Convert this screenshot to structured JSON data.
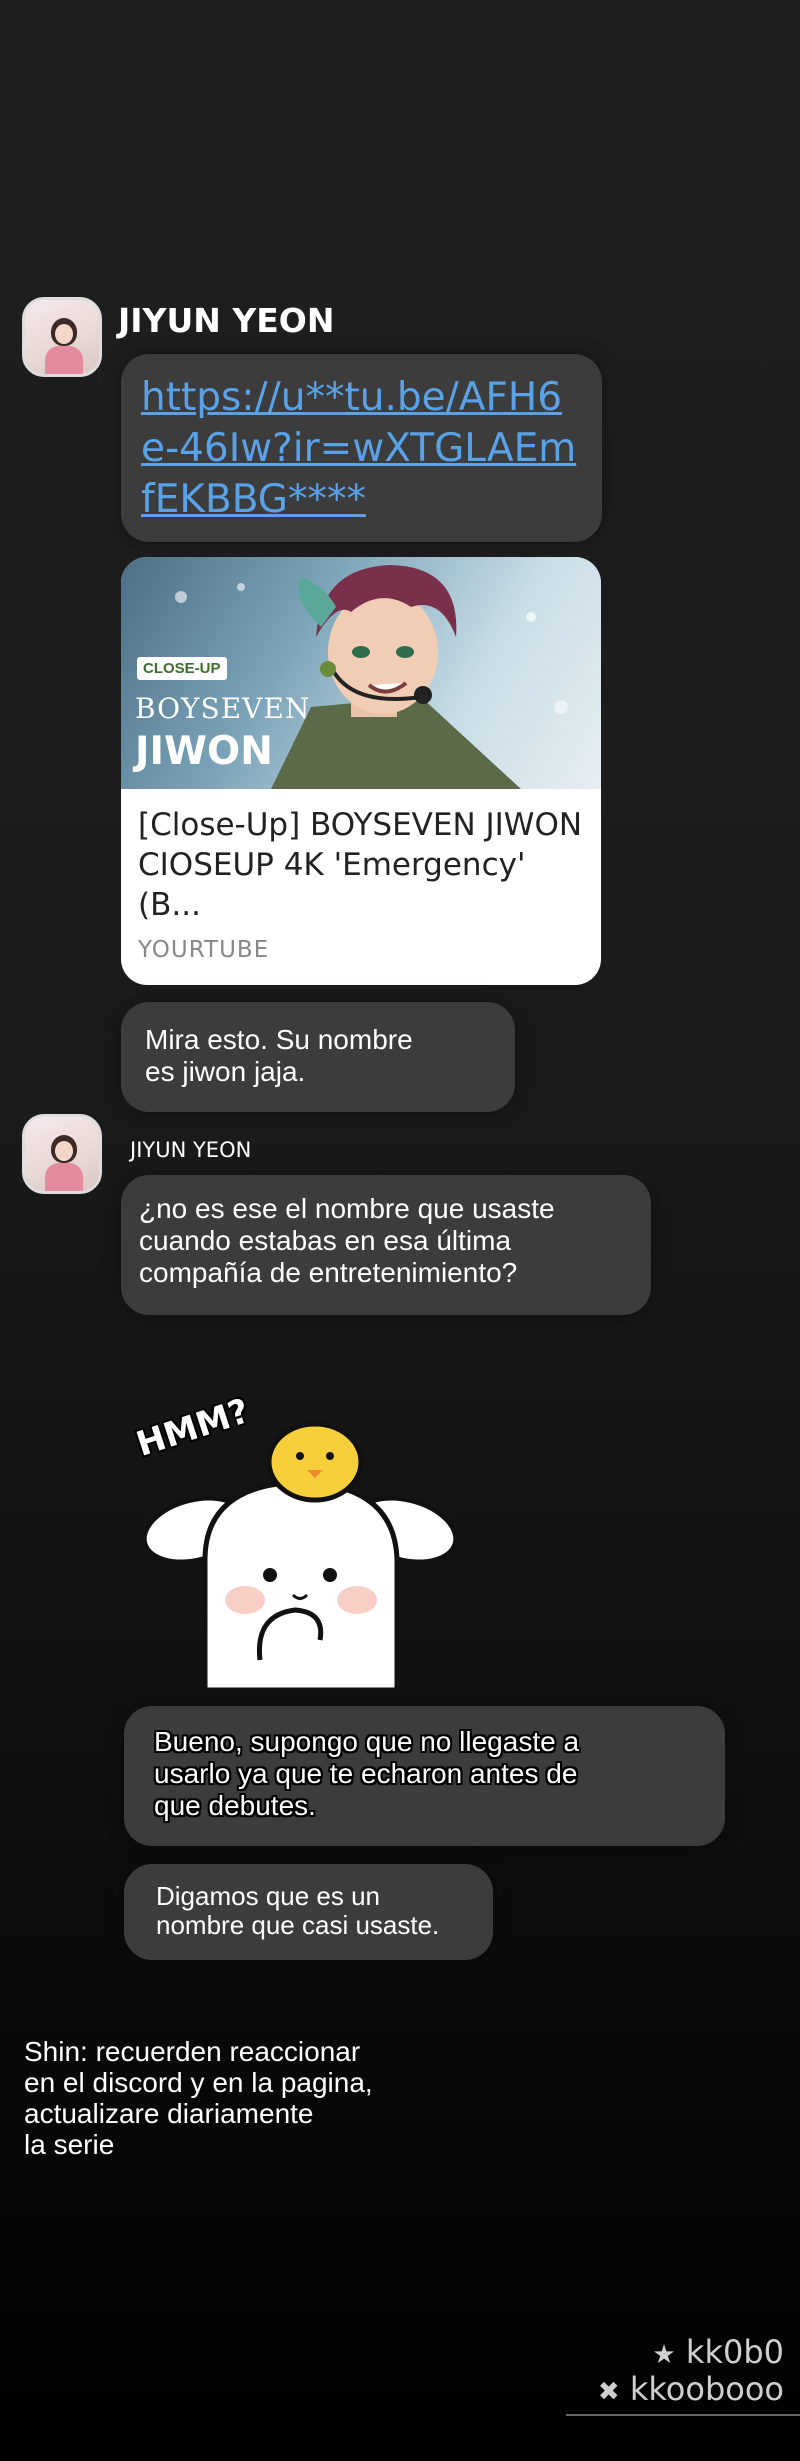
{
  "chat": {
    "sender1": {
      "name": "JIYUN YEON"
    },
    "link_message": {
      "url": "https://u**tu.be/AFH6e-46Iw?ir=wXTGLAEmfEKBBG****"
    },
    "link_card": {
      "thumb_badge": "CLOSE-UP",
      "thumb_brand": "BOYSEVEN",
      "thumb_name": "JIWON",
      "title": "[Close-Up] BOYSEVEN JIWON CIOSEUP 4K 'Emergency' (B...",
      "source": "YOURTUBE"
    },
    "message1": {
      "line1": "Mira esto. Su nombre",
      "line2": "es jiwon jaja."
    },
    "sender2": {
      "name": "JIYUN YEON"
    },
    "message2": {
      "line1": "¿no es ese el nombre que usaste",
      "line2": "cuando estabas en esa última",
      "line3": "compañía de entretenimiento?"
    },
    "sticker": {
      "text": "HMM?"
    },
    "message3": {
      "line1": "Bueno, supongo que no llegaste a",
      "line2": "usarlo ya que te echaron antes de",
      "line3": "que debutes."
    },
    "message4": {
      "line1": "Digamos que es un",
      "line2": "nombre que casi usaste."
    }
  },
  "translator_note": {
    "line1": "Shin: recuerden reaccionar",
    "line2": "en el discord y en la pagina,",
    "line3": "actualizare diariamente",
    "line4": "la serie"
  },
  "credits": {
    "line1": "kk0b0",
    "line2": "kkoobooo"
  }
}
